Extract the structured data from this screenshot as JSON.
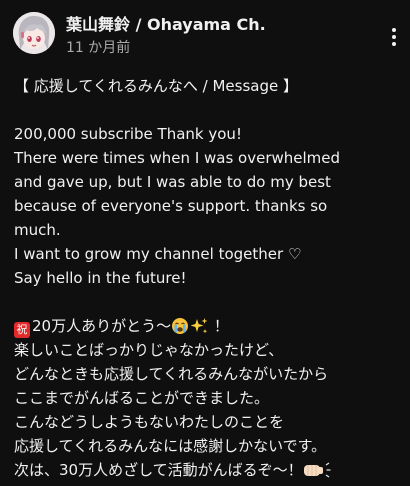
{
  "post": {
    "author": "葉山舞鈴 / Ohayama Ch.",
    "timestamp": "11 か月前",
    "more_icon": "more-vertical-icon",
    "lines": [
      "【 応援してくれるみんなへ / Message 】",
      "",
      "200,000 subscribe Thank you!",
      "There were times when I was overwhelmed",
      "and gave up, but I was able to do my best",
      "because of everyone's support. thanks so",
      "much.",
      "I want to grow my channel together ♡",
      "Say hello in the future!",
      "",
      "20万人ありがとう〜",
      "楽しいことばっかりじゃなかったけど、",
      "どんなときも応援してくれるみんながいたから",
      "ここまでがんばることができました。",
      "こんなどうしようもないわたしのことを",
      "応援してくれるみんなには感謝しかないです。",
      "次は、30万人めざして活動がんばるぞ〜！"
    ],
    "iwai_symbol": "祝",
    "line11_tail": " ！",
    "emoji_names": [
      "celebration-kanji-icon",
      "loudly-crying-face-icon",
      "sparkles-icon",
      "fist-bump-icon"
    ]
  },
  "colors": {
    "background": "#0f0f0f",
    "text": "#f1f1f1",
    "secondary_text": "#aaaaaa"
  }
}
